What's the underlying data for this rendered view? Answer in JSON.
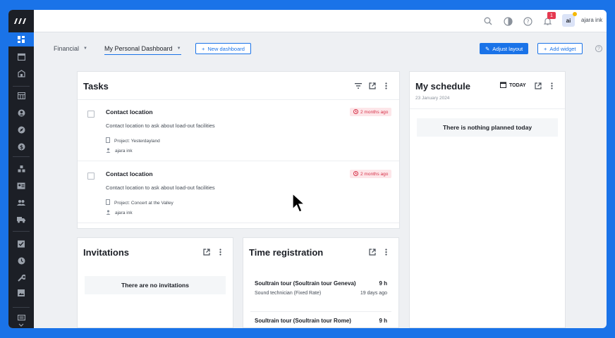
{
  "topbar": {
    "user_initials": "ai",
    "user_name": "ajara ink",
    "notification_count": "1"
  },
  "subbar": {
    "tabs": [
      {
        "label": "Financial"
      },
      {
        "label": "My Personal Dashboard",
        "active": true
      }
    ],
    "new_dashboard_label": "New dashboard",
    "adjust_layout_label": "Adjust layout",
    "add_widget_label": "Add widget",
    "help": "?"
  },
  "tasks": {
    "title": "Tasks",
    "items": [
      {
        "title": "Contact location",
        "description": "Contact location to ask about load-out facilities",
        "project": "Project: Yesterdayland",
        "assignee": "ajara ink",
        "due": "2 months ago"
      },
      {
        "title": "Contact location",
        "description": "Contact location to ask about load-out facilities",
        "project": "Project: Concert at the Valley",
        "assignee": "ajara ink",
        "due": "2 months ago"
      }
    ]
  },
  "schedule": {
    "title": "My schedule",
    "today_label": "TODAY",
    "date": "23 January 2024",
    "empty_text": "There is nothing planned today"
  },
  "invitations": {
    "title": "Invitations",
    "empty_text": "There are no invitations"
  },
  "time_registration": {
    "title": "Time registration",
    "items": [
      {
        "title": "Soultrain tour (Soultrain tour Geneva)",
        "hours": "9 h",
        "role": "Sound technician (Fixed Rate)",
        "ago": "19 days ago"
      },
      {
        "title": "Soultrain tour (Soultrain tour Rome)",
        "hours": "9 h"
      }
    ]
  },
  "colors": {
    "accent": "#1a73e8",
    "sidebar": "#1c1f26",
    "overdue": "#d6334a"
  }
}
